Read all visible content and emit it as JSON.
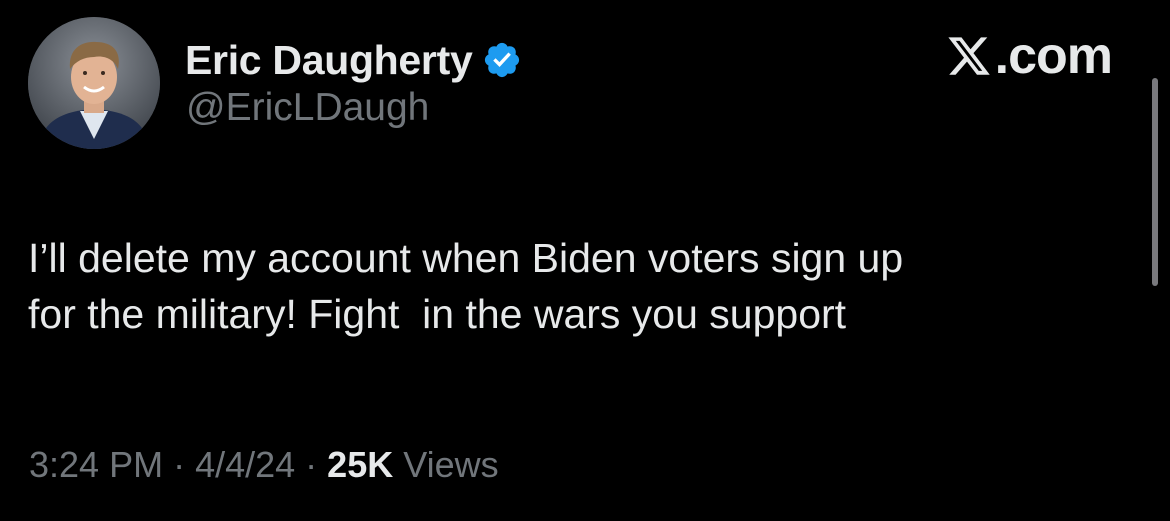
{
  "profile": {
    "display_name": "Eric Daugherty",
    "handle": "@EricLDaugh",
    "avatar_icon": "user-avatar-photo",
    "verified_icon": "verified-badge-icon",
    "verified_color": "#1d9bf0"
  },
  "brand": {
    "icon": "x-logo-icon",
    "text": ".com"
  },
  "tweet": {
    "lines": [
      "I’ll delete my account when Biden voters sign up",
      "for the military! Fight  in the wars you support"
    ]
  },
  "meta": {
    "time": "3:24 PM",
    "separator": "·",
    "date": "4/4/24",
    "views_count": "25K",
    "views_label": "Views"
  },
  "colors": {
    "background": "#000000",
    "primary_text": "#e7e9ea",
    "secondary_text": "#71767b",
    "accent": "#1d9bf0"
  }
}
